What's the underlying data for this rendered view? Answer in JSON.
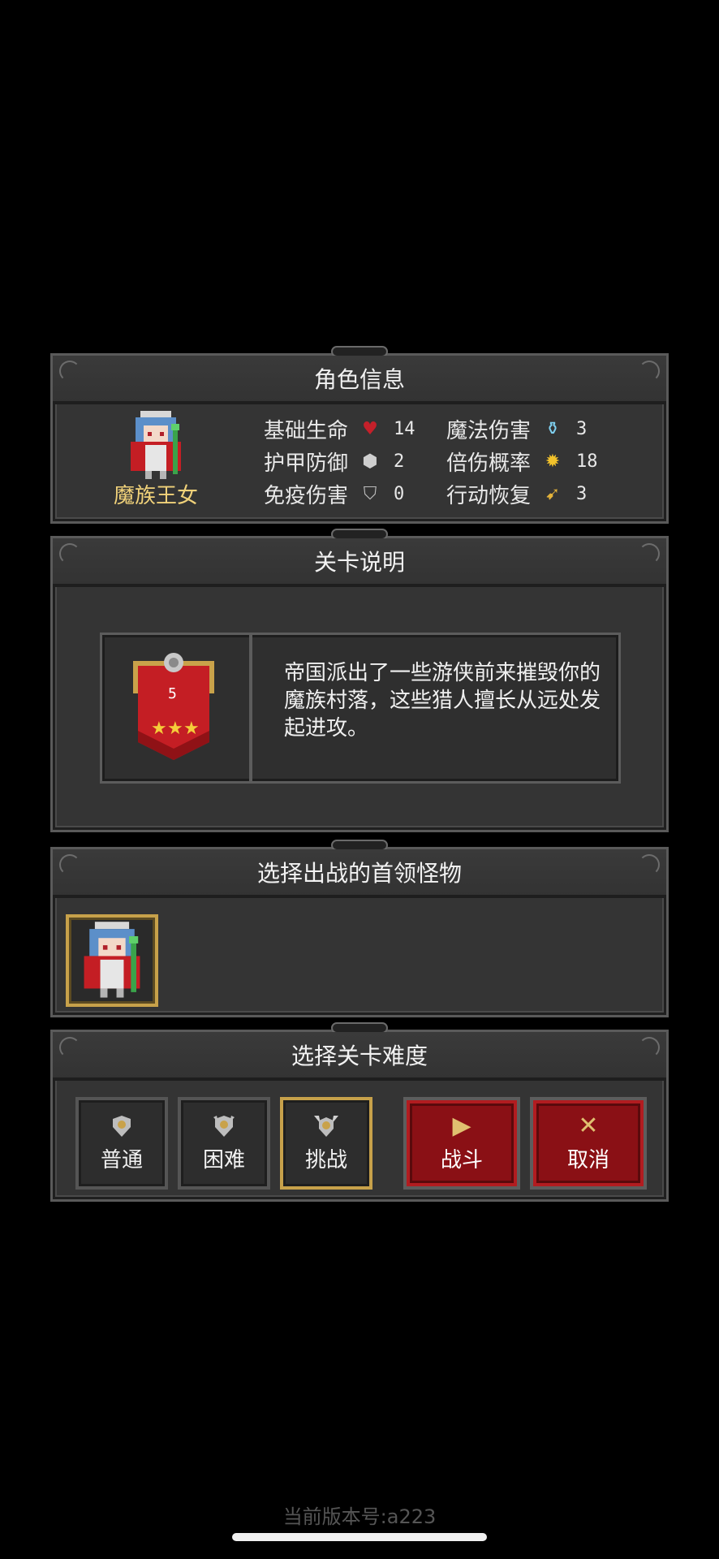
{
  "character": {
    "header": "角色信息",
    "name": "魔族王女",
    "stats": [
      {
        "label": "基础生命",
        "icon": "heart-icon",
        "value": "14"
      },
      {
        "label": "魔法伤害",
        "icon": "magic-potion-icon",
        "value": "3"
      },
      {
        "label": "护甲防御",
        "icon": "armor-shield-icon",
        "value": "2"
      },
      {
        "label": "倍伤概率",
        "icon": "crit-star-icon",
        "value": "18"
      },
      {
        "label": "免疫伤害",
        "icon": "immunity-shield-icon",
        "value": "0"
      },
      {
        "label": "行动恢复",
        "icon": "action-recover-icon",
        "value": "3"
      }
    ]
  },
  "stage": {
    "header": "关卡说明",
    "level": "5",
    "stars": 3,
    "description": "帝国派出了一些游侠前来摧毁你的魔族村落，这些猎人擅长从远处发起进攻。"
  },
  "boss": {
    "header": "选择出战的首领怪物"
  },
  "difficulty": {
    "header": "选择关卡难度",
    "options": [
      "普通",
      "困难",
      "挑战"
    ],
    "selected": "挑战",
    "fight_label": "战斗",
    "cancel_label": "取消"
  },
  "footer": {
    "version": "当前版本号:a223"
  },
  "colors": {
    "panel": "#343434",
    "gold": "#c7a14a",
    "red_button": "#8a1015",
    "name_gold": "#f1d27a"
  }
}
